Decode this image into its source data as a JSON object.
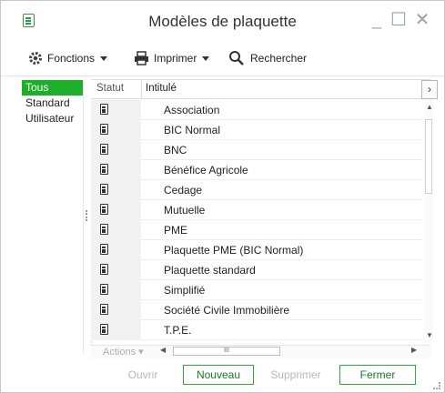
{
  "window": {
    "title": "Modèles de plaquette",
    "minimize_icon": "minimize-icon",
    "maximize_icon": "maximize-icon",
    "close_icon": "close-icon"
  },
  "toolbar": {
    "functions_label": "Fonctions",
    "print_label": "Imprimer",
    "search_label": "Rechercher"
  },
  "sidebar": {
    "items": [
      {
        "label": "Tous",
        "selected": true
      },
      {
        "label": "Standard",
        "selected": false
      },
      {
        "label": "Utilisateur",
        "selected": false
      }
    ]
  },
  "grid": {
    "columns": [
      "Statut",
      "Intitulé"
    ],
    "rows": [
      {
        "label": "Association"
      },
      {
        "label": "BIC Normal"
      },
      {
        "label": "BNC"
      },
      {
        "label": "Bénéfice Agricole"
      },
      {
        "label": "Cedage"
      },
      {
        "label": "Mutuelle"
      },
      {
        "label": "PME"
      },
      {
        "label": "Plaquette PME (BIC Normal)"
      },
      {
        "label": "Plaquette standard"
      },
      {
        "label": "Simplifié"
      },
      {
        "label": "Société Civile Immobilière"
      },
      {
        "label": "T.P.E."
      }
    ],
    "actions_label": "Actions",
    "hscroll_grip": "III"
  },
  "footer": {
    "open_label": "Ouvrir",
    "new_label": "Nouveau",
    "delete_label": "Supprimer",
    "close_label": "Fermer"
  },
  "colors": {
    "accent": "#1fae2b",
    "disabled": "#b8b8b8"
  }
}
